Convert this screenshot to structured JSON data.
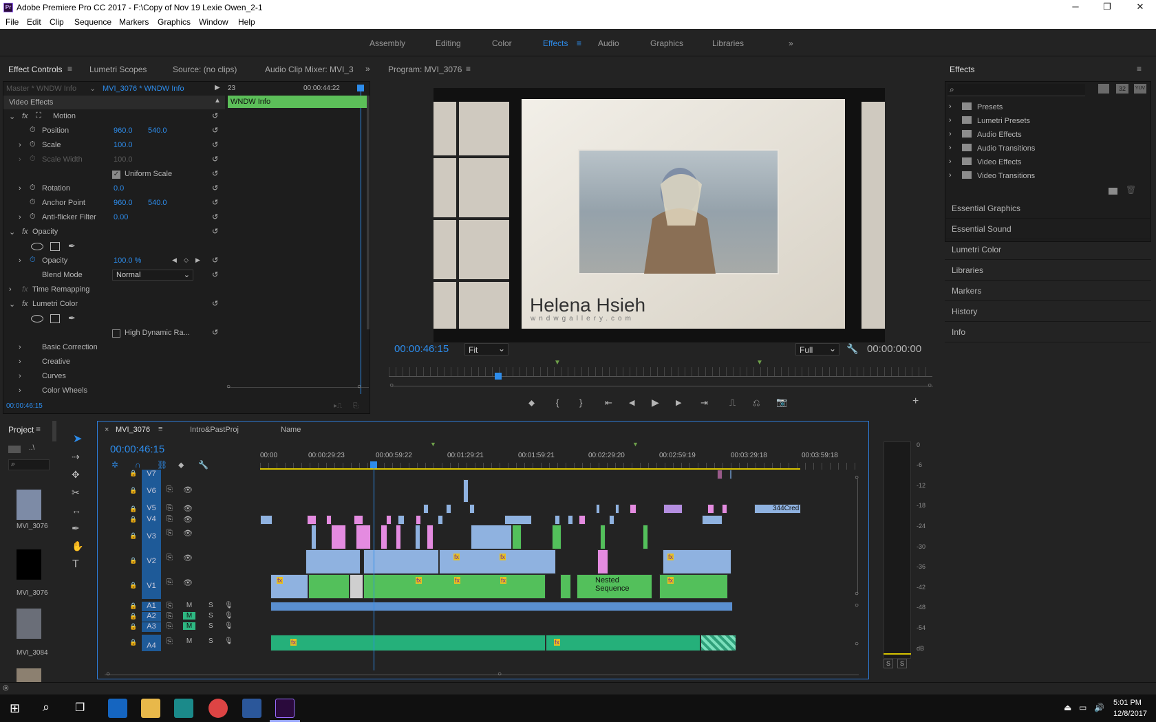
{
  "window": {
    "title": "Adobe Premiere Pro CC 2017 - F:\\Copy of Nov 19 Lexie Owen_2-1",
    "logo_text": "Pr",
    "minimize": "─",
    "maximize": "❐",
    "close": "✕"
  },
  "menu": [
    "File",
    "Edit",
    "Clip",
    "Sequence",
    "Markers",
    "Graphics",
    "Window",
    "Help"
  ],
  "workspaces": {
    "items": [
      "Assembly",
      "Editing",
      "Color",
      "Effects",
      "Audio",
      "Graphics",
      "Libraries"
    ],
    "active": "Effects",
    "overflow": "»"
  },
  "effect_controls": {
    "tabs": [
      "Effect Controls",
      "Lumetri Scopes",
      "Source: (no clips)",
      "Audio Clip Mixer: MVI_3"
    ],
    "overflow": "»",
    "master": "Master * WNDW Info",
    "sequence_clip": "MVI_3076 * WNDW Info",
    "mini_time_left": "23",
    "mini_time": "00:00:44:22",
    "clip_bar": "WNDW Info",
    "section_video": "Video Effects",
    "motion": "Motion",
    "fx": "fx",
    "props": [
      {
        "name": "Position",
        "v1": "960.0",
        "v2": "540.0"
      },
      {
        "name": "Scale",
        "v1": "100.0",
        "v2": ""
      },
      {
        "name": "Scale Width",
        "v1": "100.0",
        "v2": ""
      },
      {
        "name": "Rotation",
        "v1": "0.0",
        "v2": ""
      },
      {
        "name": "Anchor Point",
        "v1": "960.0",
        "v2": "540.0"
      },
      {
        "name": "Anti-flicker Filter",
        "v1": "0.00",
        "v2": ""
      }
    ],
    "uniform_scale": "Uniform Scale",
    "opacity_group": "Opacity",
    "opacity_label": "Opacity",
    "opacity_value": "100.0 %",
    "blend_mode_label": "Blend Mode",
    "blend_mode": "Normal",
    "time_remapping": "Time Remapping",
    "lumetri": "Lumetri Color",
    "hdr": "High Dynamic Ra...",
    "subs": [
      "Basic Correction",
      "Creative",
      "Curves",
      "Color Wheels"
    ],
    "timecode": "00:00:46:15"
  },
  "program": {
    "title": "Program: MVI_3076",
    "timecode": "00:00:46:15",
    "fit": "Fit",
    "full": "Full",
    "duration": "00:00:00:00",
    "watermark_name": "Helena Hsieh",
    "watermark_sub": "wndwgallery.com",
    "controls": [
      "marker-icon",
      "in-point-icon",
      "out-point-icon",
      "go-to-in-icon",
      "step-back-icon",
      "play-icon",
      "step-forward-icon",
      "go-to-out-icon",
      "lift-icon",
      "extract-icon",
      "export-frame-icon",
      "add-button-icon"
    ],
    "control_glyphs": [
      "⬥",
      "{",
      "}",
      "⇤",
      "◀",
      "▶",
      "▶",
      "⇥",
      "⎍",
      "⎌",
      "📷",
      "+"
    ]
  },
  "effects_panel": {
    "title": "Effects",
    "search_placeholder": "",
    "icon_labels": [
      "32",
      "YUV"
    ],
    "folders": [
      "Presets",
      "Lumetri Presets",
      "Audio Effects",
      "Audio Transitions",
      "Video Effects",
      "Video Transitions"
    ],
    "sections": [
      "Essential Graphics",
      "Essential Sound",
      "Lumetri Color",
      "Libraries",
      "Markers",
      "History",
      "Info"
    ]
  },
  "project": {
    "title": "Project",
    "bin_label": "..\\",
    "items": [
      "MVI_3076",
      "MVI_3076",
      "MVI_3084"
    ]
  },
  "timeline": {
    "tabs": [
      "MVI_3076",
      "Intro&PastProj",
      "Name"
    ],
    "close": "×",
    "timecode": "00:00:46:15",
    "ruler": [
      "00:00",
      "00:00:29:23",
      "00:00:59:22",
      "00:01:29:21",
      "00:01:59:21",
      "00:02:29:20",
      "00:02:59:19",
      "00:03:29:18",
      "00:03:59:18"
    ],
    "video_tracks": [
      "V7",
      "V6",
      "V5",
      "V4",
      "V3",
      "V2",
      "V1"
    ],
    "audio_tracks": [
      "A1",
      "A2",
      "A3",
      "A4"
    ],
    "mute": "M",
    "solo": "S",
    "fx_label": "fx",
    "nested_label": "Nested Sequence",
    "clip_label_344": "344Cred"
  },
  "meter": {
    "scale": [
      "0",
      "-6",
      "-12",
      "-18",
      "-24",
      "-30",
      "-36",
      "-42",
      "-48",
      "-54",
      "dB"
    ],
    "solo": [
      "S",
      "S"
    ]
  },
  "taskbar": {
    "time": "5:01 PM",
    "date": "12/8/2017"
  },
  "colors": {
    "accent": "#2d8ceb",
    "video_clip": "#8fb2e0",
    "green_clip": "#53c05b",
    "pink_clip": "#e48be0",
    "audio_clip": "#25b07a"
  }
}
